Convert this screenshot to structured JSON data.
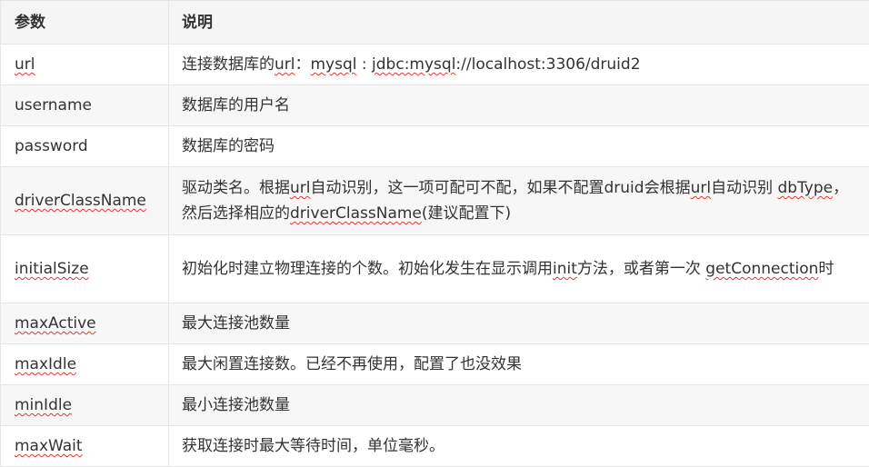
{
  "table": {
    "headers": {
      "param": "参数",
      "desc": "说明"
    },
    "rows": [
      {
        "param": "url",
        "param_spell": true,
        "desc_parts": [
          {
            "t": "连接数据库的",
            "s": false
          },
          {
            "t": "url",
            "s": true
          },
          {
            "t": "：",
            "s": false
          },
          {
            "t": "mysql",
            "s": true
          },
          {
            "t": " : ",
            "s": false
          },
          {
            "t": "jdbc:mysql",
            "s": true
          },
          {
            "t": "://localhost:3306/druid2",
            "s": false
          }
        ]
      },
      {
        "param": "username",
        "param_spell": false,
        "desc_parts": [
          {
            "t": "数据库的用户名",
            "s": false
          }
        ]
      },
      {
        "param": "password",
        "param_spell": false,
        "desc_parts": [
          {
            "t": "数据库的密码",
            "s": false
          }
        ]
      },
      {
        "param": "driverClassName",
        "param_spell": true,
        "tall": true,
        "desc_parts": [
          {
            "t": "驱动类名。根据",
            "s": false
          },
          {
            "t": "url",
            "s": true
          },
          {
            "t": "自动识别，这一项可配可不配，如果不配置druid会根据",
            "s": false
          },
          {
            "t": "url",
            "s": true
          },
          {
            "t": "自动识别 ",
            "s": false
          },
          {
            "t": "dbType",
            "s": true
          },
          {
            "t": "，然后选择相应的",
            "s": false
          },
          {
            "t": "driverClassName",
            "s": true
          },
          {
            "t": "(建议配置下)",
            "s": false
          }
        ]
      },
      {
        "param": "initialSize",
        "param_spell": true,
        "tall": true,
        "desc_parts": [
          {
            "t": "初始化时建立物理连接的个数。初始化发生在显示调用",
            "s": false
          },
          {
            "t": "init",
            "s": true
          },
          {
            "t": "方法，或者第一次 ",
            "s": false
          },
          {
            "t": "getConnection",
            "s": true
          },
          {
            "t": "时",
            "s": false
          }
        ]
      },
      {
        "param": "maxActive",
        "param_spell": true,
        "desc_parts": [
          {
            "t": "最大连接池数量",
            "s": false
          }
        ]
      },
      {
        "param": "maxIdle",
        "param_spell": true,
        "desc_parts": [
          {
            "t": "最大闲置连接数。已经不再使用，配置了也没效果",
            "s": false
          }
        ]
      },
      {
        "param": "minIdle",
        "param_spell": true,
        "desc_parts": [
          {
            "t": "最小连接池数量",
            "s": false
          }
        ]
      },
      {
        "param": "maxWait",
        "param_spell": true,
        "desc_parts": [
          {
            "t": "获取连接时最大等待时间，单位毫秒。",
            "s": false
          }
        ]
      }
    ]
  }
}
